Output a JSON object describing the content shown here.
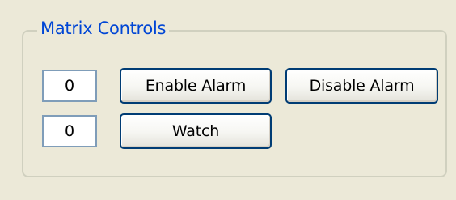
{
  "group": {
    "title": "Matrix Controls"
  },
  "fields": [
    {
      "value": "0"
    },
    {
      "value": "0"
    }
  ],
  "buttons": {
    "enable_alarm": "Enable Alarm",
    "disable_alarm": "Disable Alarm",
    "watch": "Watch"
  },
  "colors": {
    "background": "#ECE9D8",
    "legend_text": "#0046D5",
    "button_border": "#003C74",
    "field_border": "#7F9DB9",
    "group_border": "#D0D0BF"
  }
}
